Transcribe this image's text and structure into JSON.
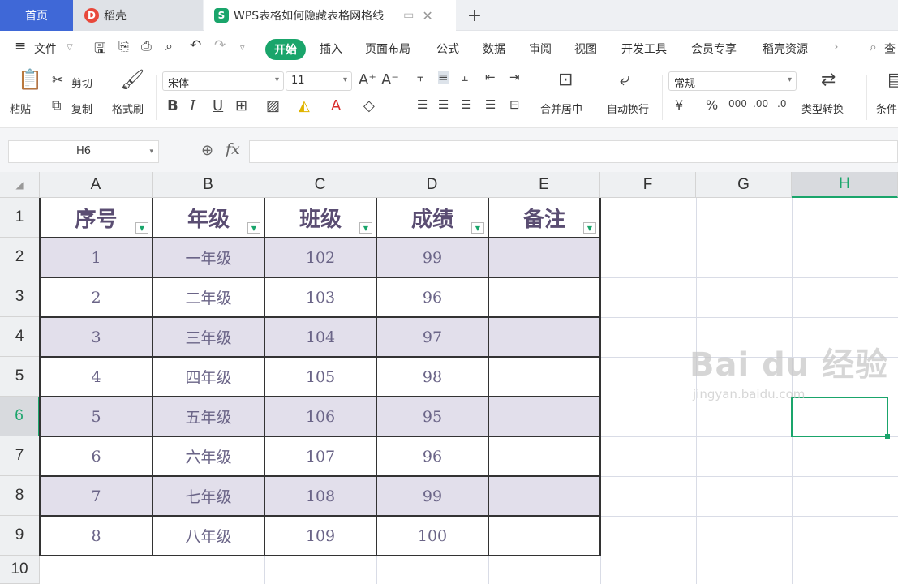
{
  "tabs": {
    "home": "首页",
    "daoke": "稻壳",
    "document": "WPS表格如何隐藏表格网格线",
    "doc_icon": "S",
    "plus": "+"
  },
  "menu": {
    "hamburger": "≡",
    "file": "文件",
    "start": "开始",
    "items": [
      "插入",
      "页面布局",
      "公式",
      "数据",
      "审阅",
      "视图",
      "开发工具",
      "会员专享",
      "稻壳资源"
    ],
    "search": "查"
  },
  "ribbon": {
    "paste": "粘贴",
    "cut": "剪切",
    "copy": "复制",
    "format_painter": "格式刷",
    "font_name": "宋体",
    "font_size": "11",
    "merge_center": "合并居中",
    "wrap_text": "自动换行",
    "number_format": "常规",
    "type_convert": "类型转换",
    "conditional": "条件"
  },
  "formula_bar": {
    "cell_ref": "H6",
    "fx": "fx",
    "formula": ""
  },
  "sheet": {
    "columns": [
      "A",
      "B",
      "C",
      "D",
      "E",
      "F",
      "G",
      "H"
    ],
    "selected_column": "H",
    "rows": [
      "1",
      "2",
      "3",
      "4",
      "5",
      "6",
      "7",
      "8",
      "9",
      "10"
    ],
    "selected_row": "6",
    "headers": [
      "序号",
      "年级",
      "班级",
      "成绩",
      "备注"
    ],
    "data": [
      [
        "1",
        "一年级",
        "102",
        "99",
        ""
      ],
      [
        "2",
        "二年级",
        "103",
        "96",
        ""
      ],
      [
        "3",
        "三年级",
        "104",
        "97",
        ""
      ],
      [
        "4",
        "四年级",
        "105",
        "98",
        ""
      ],
      [
        "5",
        "五年级",
        "106",
        "95",
        ""
      ],
      [
        "6",
        "六年级",
        "107",
        "96",
        ""
      ],
      [
        "7",
        "七年级",
        "108",
        "99",
        ""
      ],
      [
        "8",
        "八年级",
        "109",
        "100",
        ""
      ]
    ]
  },
  "watermark": {
    "line1": "Bai du 经验",
    "line2": "jingyan.baidu.com"
  },
  "colors": {
    "accent": "#1aa56b",
    "home_tab": "#3f68d7",
    "band": "#e2dfeb",
    "cell_text": "#6a6487"
  }
}
